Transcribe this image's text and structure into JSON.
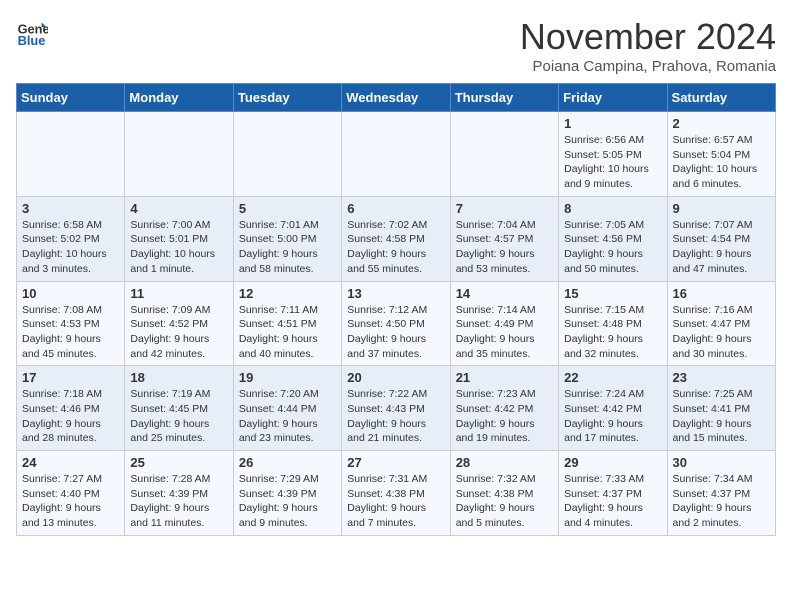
{
  "logo": {
    "general": "General",
    "blue": "Blue"
  },
  "title": "November 2024",
  "subtitle": "Poiana Campina, Prahova, Romania",
  "headers": [
    "Sunday",
    "Monday",
    "Tuesday",
    "Wednesday",
    "Thursday",
    "Friday",
    "Saturday"
  ],
  "weeks": [
    [
      {
        "num": "",
        "info": ""
      },
      {
        "num": "",
        "info": ""
      },
      {
        "num": "",
        "info": ""
      },
      {
        "num": "",
        "info": ""
      },
      {
        "num": "",
        "info": ""
      },
      {
        "num": "1",
        "info": "Sunrise: 6:56 AM\nSunset: 5:05 PM\nDaylight: 10 hours and 9 minutes."
      },
      {
        "num": "2",
        "info": "Sunrise: 6:57 AM\nSunset: 5:04 PM\nDaylight: 10 hours and 6 minutes."
      }
    ],
    [
      {
        "num": "3",
        "info": "Sunrise: 6:58 AM\nSunset: 5:02 PM\nDaylight: 10 hours and 3 minutes."
      },
      {
        "num": "4",
        "info": "Sunrise: 7:00 AM\nSunset: 5:01 PM\nDaylight: 10 hours and 1 minute."
      },
      {
        "num": "5",
        "info": "Sunrise: 7:01 AM\nSunset: 5:00 PM\nDaylight: 9 hours and 58 minutes."
      },
      {
        "num": "6",
        "info": "Sunrise: 7:02 AM\nSunset: 4:58 PM\nDaylight: 9 hours and 55 minutes."
      },
      {
        "num": "7",
        "info": "Sunrise: 7:04 AM\nSunset: 4:57 PM\nDaylight: 9 hours and 53 minutes."
      },
      {
        "num": "8",
        "info": "Sunrise: 7:05 AM\nSunset: 4:56 PM\nDaylight: 9 hours and 50 minutes."
      },
      {
        "num": "9",
        "info": "Sunrise: 7:07 AM\nSunset: 4:54 PM\nDaylight: 9 hours and 47 minutes."
      }
    ],
    [
      {
        "num": "10",
        "info": "Sunrise: 7:08 AM\nSunset: 4:53 PM\nDaylight: 9 hours and 45 minutes."
      },
      {
        "num": "11",
        "info": "Sunrise: 7:09 AM\nSunset: 4:52 PM\nDaylight: 9 hours and 42 minutes."
      },
      {
        "num": "12",
        "info": "Sunrise: 7:11 AM\nSunset: 4:51 PM\nDaylight: 9 hours and 40 minutes."
      },
      {
        "num": "13",
        "info": "Sunrise: 7:12 AM\nSunset: 4:50 PM\nDaylight: 9 hours and 37 minutes."
      },
      {
        "num": "14",
        "info": "Sunrise: 7:14 AM\nSunset: 4:49 PM\nDaylight: 9 hours and 35 minutes."
      },
      {
        "num": "15",
        "info": "Sunrise: 7:15 AM\nSunset: 4:48 PM\nDaylight: 9 hours and 32 minutes."
      },
      {
        "num": "16",
        "info": "Sunrise: 7:16 AM\nSunset: 4:47 PM\nDaylight: 9 hours and 30 minutes."
      }
    ],
    [
      {
        "num": "17",
        "info": "Sunrise: 7:18 AM\nSunset: 4:46 PM\nDaylight: 9 hours and 28 minutes."
      },
      {
        "num": "18",
        "info": "Sunrise: 7:19 AM\nSunset: 4:45 PM\nDaylight: 9 hours and 25 minutes."
      },
      {
        "num": "19",
        "info": "Sunrise: 7:20 AM\nSunset: 4:44 PM\nDaylight: 9 hours and 23 minutes."
      },
      {
        "num": "20",
        "info": "Sunrise: 7:22 AM\nSunset: 4:43 PM\nDaylight: 9 hours and 21 minutes."
      },
      {
        "num": "21",
        "info": "Sunrise: 7:23 AM\nSunset: 4:42 PM\nDaylight: 9 hours and 19 minutes."
      },
      {
        "num": "22",
        "info": "Sunrise: 7:24 AM\nSunset: 4:42 PM\nDaylight: 9 hours and 17 minutes."
      },
      {
        "num": "23",
        "info": "Sunrise: 7:25 AM\nSunset: 4:41 PM\nDaylight: 9 hours and 15 minutes."
      }
    ],
    [
      {
        "num": "24",
        "info": "Sunrise: 7:27 AM\nSunset: 4:40 PM\nDaylight: 9 hours and 13 minutes."
      },
      {
        "num": "25",
        "info": "Sunrise: 7:28 AM\nSunset: 4:39 PM\nDaylight: 9 hours and 11 minutes."
      },
      {
        "num": "26",
        "info": "Sunrise: 7:29 AM\nSunset: 4:39 PM\nDaylight: 9 hours and 9 minutes."
      },
      {
        "num": "27",
        "info": "Sunrise: 7:31 AM\nSunset: 4:38 PM\nDaylight: 9 hours and 7 minutes."
      },
      {
        "num": "28",
        "info": "Sunrise: 7:32 AM\nSunset: 4:38 PM\nDaylight: 9 hours and 5 minutes."
      },
      {
        "num": "29",
        "info": "Sunrise: 7:33 AM\nSunset: 4:37 PM\nDaylight: 9 hours and 4 minutes."
      },
      {
        "num": "30",
        "info": "Sunrise: 7:34 AM\nSunset: 4:37 PM\nDaylight: 9 hours and 2 minutes."
      }
    ]
  ]
}
